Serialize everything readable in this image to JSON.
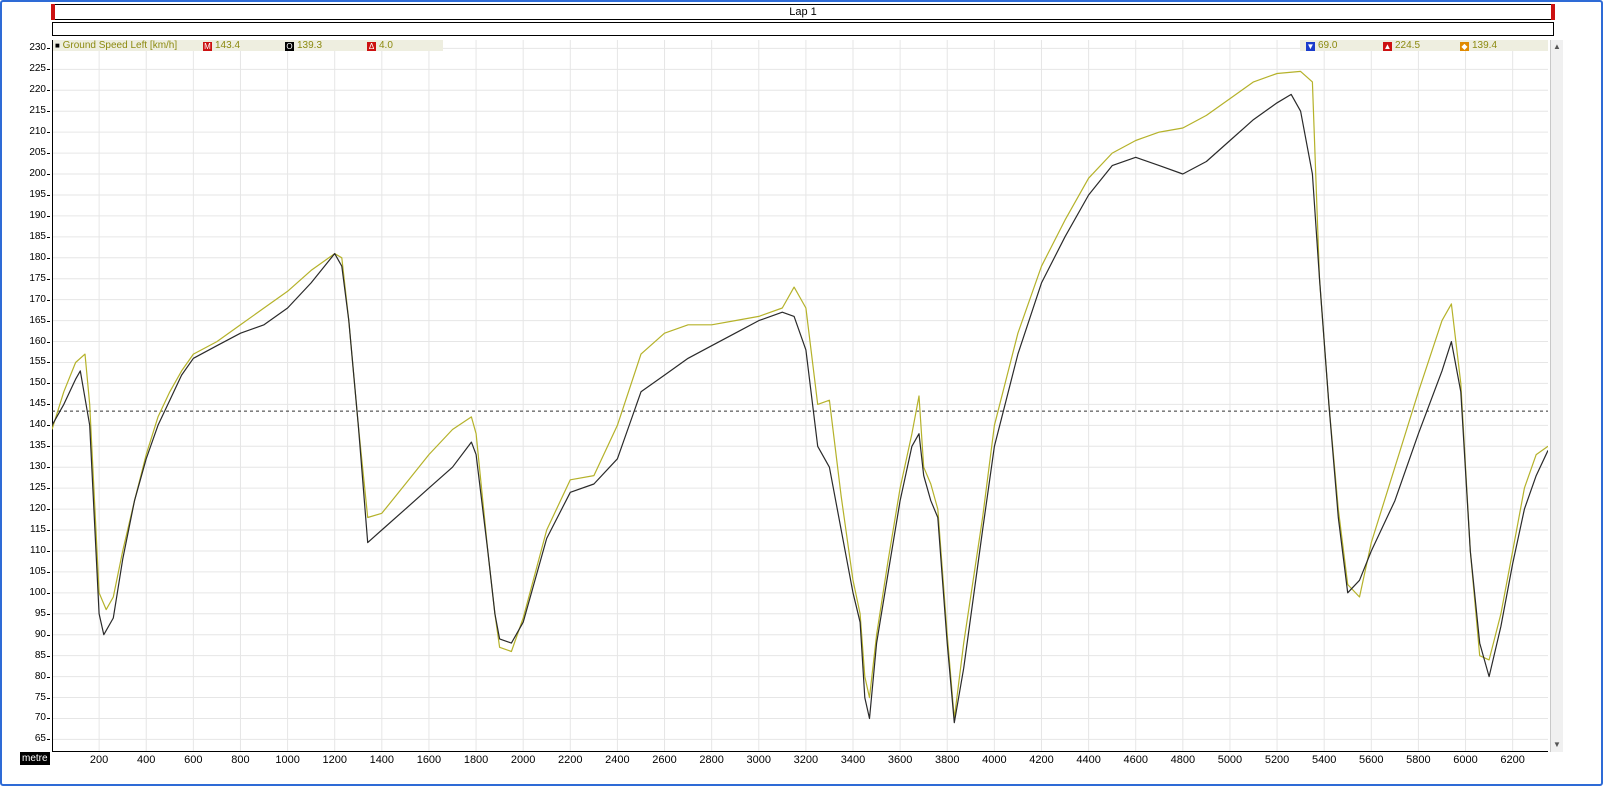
{
  "lap": {
    "label": "Lap 1"
  },
  "x_unit": "metre",
  "legend": {
    "channel": "Ground Speed Left [km/h]",
    "items": [
      {
        "icon": "M",
        "icon_name": "m-marker-icon",
        "color": "#cc1111",
        "value": "143.4"
      },
      {
        "icon": "O",
        "icon_name": "o-marker-icon",
        "color": "#000000",
        "value": "139.3"
      },
      {
        "icon": "Δ",
        "icon_name": "delta-icon",
        "color": "#cc1111",
        "value": "4.0"
      }
    ],
    "stats": [
      {
        "icon": "▼",
        "icon_name": "min-icon",
        "color": "#1a3ccc",
        "value": "69.0"
      },
      {
        "icon": "▲",
        "icon_name": "max-icon",
        "color": "#cc1111",
        "value": "224.5"
      },
      {
        "icon": "◆",
        "icon_name": "avg-icon",
        "color": "#e08a00",
        "value": "139.4"
      }
    ]
  },
  "chart_data": {
    "type": "line",
    "xlim": [
      0,
      6350
    ],
    "ylim": [
      62,
      232
    ],
    "x_ticks": [
      200,
      400,
      600,
      800,
      1000,
      1200,
      1400,
      1600,
      1800,
      2000,
      2200,
      2400,
      2600,
      2800,
      3000,
      3200,
      3400,
      3600,
      3800,
      4000,
      4200,
      4400,
      4600,
      4800,
      5000,
      5200,
      5400,
      5600,
      5800,
      6000,
      6200
    ],
    "y_ticks": [
      65,
      70,
      75,
      80,
      85,
      90,
      95,
      100,
      105,
      110,
      115,
      120,
      125,
      130,
      135,
      140,
      145,
      150,
      155,
      160,
      165,
      170,
      175,
      180,
      185,
      190,
      195,
      200,
      205,
      210,
      215,
      220,
      225,
      230
    ],
    "grid": true,
    "reference_line": {
      "y": 143.4,
      "style": "dashed"
    },
    "series": [
      {
        "name": "Ground Speed Left [km/h]",
        "color": "#b5b22a",
        "points": [
          [
            0,
            139
          ],
          [
            50,
            148
          ],
          [
            100,
            155
          ],
          [
            140,
            157
          ],
          [
            160,
            145
          ],
          [
            200,
            100
          ],
          [
            230,
            96
          ],
          [
            260,
            99
          ],
          [
            300,
            110
          ],
          [
            350,
            122
          ],
          [
            400,
            133
          ],
          [
            450,
            142
          ],
          [
            500,
            148
          ],
          [
            550,
            153
          ],
          [
            600,
            157
          ],
          [
            700,
            160
          ],
          [
            800,
            164
          ],
          [
            900,
            168
          ],
          [
            1000,
            172
          ],
          [
            1100,
            177
          ],
          [
            1200,
            181
          ],
          [
            1230,
            180
          ],
          [
            1260,
            165
          ],
          [
            1300,
            140
          ],
          [
            1340,
            118
          ],
          [
            1400,
            119
          ],
          [
            1500,
            126
          ],
          [
            1600,
            133
          ],
          [
            1700,
            139
          ],
          [
            1780,
            142
          ],
          [
            1800,
            138
          ],
          [
            1850,
            110
          ],
          [
            1880,
            95
          ],
          [
            1900,
            87
          ],
          [
            1950,
            86
          ],
          [
            2000,
            94
          ],
          [
            2100,
            115
          ],
          [
            2200,
            127
          ],
          [
            2300,
            128
          ],
          [
            2400,
            140
          ],
          [
            2500,
            157
          ],
          [
            2600,
            162
          ],
          [
            2700,
            164
          ],
          [
            2800,
            164
          ],
          [
            2900,
            165
          ],
          [
            3000,
            166
          ],
          [
            3100,
            168
          ],
          [
            3150,
            173
          ],
          [
            3200,
            168
          ],
          [
            3250,
            145
          ],
          [
            3300,
            146
          ],
          [
            3350,
            123
          ],
          [
            3400,
            103
          ],
          [
            3430,
            95
          ],
          [
            3450,
            80
          ],
          [
            3470,
            75
          ],
          [
            3500,
            90
          ],
          [
            3550,
            108
          ],
          [
            3600,
            125
          ],
          [
            3650,
            138
          ],
          [
            3680,
            147
          ],
          [
            3700,
            130
          ],
          [
            3730,
            126
          ],
          [
            3760,
            120
          ],
          [
            3800,
            90
          ],
          [
            3830,
            70
          ],
          [
            3870,
            88
          ],
          [
            3950,
            118
          ],
          [
            4000,
            140
          ],
          [
            4100,
            162
          ],
          [
            4200,
            178
          ],
          [
            4300,
            189
          ],
          [
            4400,
            199
          ],
          [
            4500,
            205
          ],
          [
            4600,
            208
          ],
          [
            4700,
            210
          ],
          [
            4800,
            211
          ],
          [
            4900,
            214
          ],
          [
            5000,
            218
          ],
          [
            5100,
            222
          ],
          [
            5200,
            224
          ],
          [
            5300,
            224.5
          ],
          [
            5350,
            222
          ],
          [
            5380,
            175
          ],
          [
            5420,
            145
          ],
          [
            5460,
            120
          ],
          [
            5500,
            102
          ],
          [
            5550,
            99
          ],
          [
            5600,
            112
          ],
          [
            5700,
            130
          ],
          [
            5800,
            148
          ],
          [
            5900,
            165
          ],
          [
            5940,
            169
          ],
          [
            5980,
            150
          ],
          [
            6020,
            110
          ],
          [
            6060,
            85
          ],
          [
            6100,
            84
          ],
          [
            6150,
            95
          ],
          [
            6200,
            110
          ],
          [
            6250,
            125
          ],
          [
            6300,
            133
          ],
          [
            6350,
            135
          ]
        ]
      },
      {
        "name": "",
        "color": "#2a2a2a",
        "points": [
          [
            0,
            140
          ],
          [
            50,
            145
          ],
          [
            100,
            151
          ],
          [
            120,
            153
          ],
          [
            160,
            140
          ],
          [
            200,
            95
          ],
          [
            220,
            90
          ],
          [
            260,
            94
          ],
          [
            300,
            108
          ],
          [
            350,
            122
          ],
          [
            400,
            132
          ],
          [
            450,
            140
          ],
          [
            500,
            146
          ],
          [
            550,
            152
          ],
          [
            600,
            156
          ],
          [
            700,
            159
          ],
          [
            800,
            162
          ],
          [
            900,
            164
          ],
          [
            1000,
            168
          ],
          [
            1100,
            174
          ],
          [
            1200,
            181
          ],
          [
            1230,
            178
          ],
          [
            1260,
            165
          ],
          [
            1300,
            140
          ],
          [
            1340,
            112
          ],
          [
            1400,
            115
          ],
          [
            1500,
            120
          ],
          [
            1600,
            125
          ],
          [
            1700,
            130
          ],
          [
            1780,
            136
          ],
          [
            1800,
            133
          ],
          [
            1850,
            110
          ],
          [
            1880,
            95
          ],
          [
            1900,
            89
          ],
          [
            1950,
            88
          ],
          [
            2000,
            93
          ],
          [
            2100,
            113
          ],
          [
            2200,
            124
          ],
          [
            2300,
            126
          ],
          [
            2400,
            132
          ],
          [
            2500,
            148
          ],
          [
            2600,
            152
          ],
          [
            2700,
            156
          ],
          [
            2800,
            159
          ],
          [
            2900,
            162
          ],
          [
            3000,
            165
          ],
          [
            3100,
            167
          ],
          [
            3150,
            166
          ],
          [
            3200,
            158
          ],
          [
            3250,
            135
          ],
          [
            3300,
            130
          ],
          [
            3350,
            115
          ],
          [
            3400,
            100
          ],
          [
            3430,
            93
          ],
          [
            3450,
            75
          ],
          [
            3470,
            70
          ],
          [
            3500,
            88
          ],
          [
            3550,
            105
          ],
          [
            3600,
            122
          ],
          [
            3650,
            135
          ],
          [
            3680,
            138
          ],
          [
            3700,
            128
          ],
          [
            3730,
            122
          ],
          [
            3760,
            118
          ],
          [
            3800,
            88
          ],
          [
            3830,
            69
          ],
          [
            3870,
            82
          ],
          [
            3950,
            115
          ],
          [
            4000,
            135
          ],
          [
            4100,
            157
          ],
          [
            4200,
            174
          ],
          [
            4300,
            185
          ],
          [
            4400,
            195
          ],
          [
            4500,
            202
          ],
          [
            4600,
            204
          ],
          [
            4700,
            202
          ],
          [
            4800,
            200
          ],
          [
            4900,
            203
          ],
          [
            5000,
            208
          ],
          [
            5100,
            213
          ],
          [
            5200,
            217
          ],
          [
            5260,
            219
          ],
          [
            5300,
            215
          ],
          [
            5350,
            200
          ],
          [
            5380,
            175
          ],
          [
            5420,
            145
          ],
          [
            5460,
            118
          ],
          [
            5500,
            100
          ],
          [
            5550,
            103
          ],
          [
            5600,
            110
          ],
          [
            5700,
            122
          ],
          [
            5800,
            138
          ],
          [
            5900,
            153
          ],
          [
            5940,
            160
          ],
          [
            5980,
            148
          ],
          [
            6020,
            110
          ],
          [
            6060,
            88
          ],
          [
            6100,
            80
          ],
          [
            6150,
            92
          ],
          [
            6200,
            107
          ],
          [
            6250,
            120
          ],
          [
            6300,
            128
          ],
          [
            6350,
            134
          ]
        ]
      }
    ]
  }
}
